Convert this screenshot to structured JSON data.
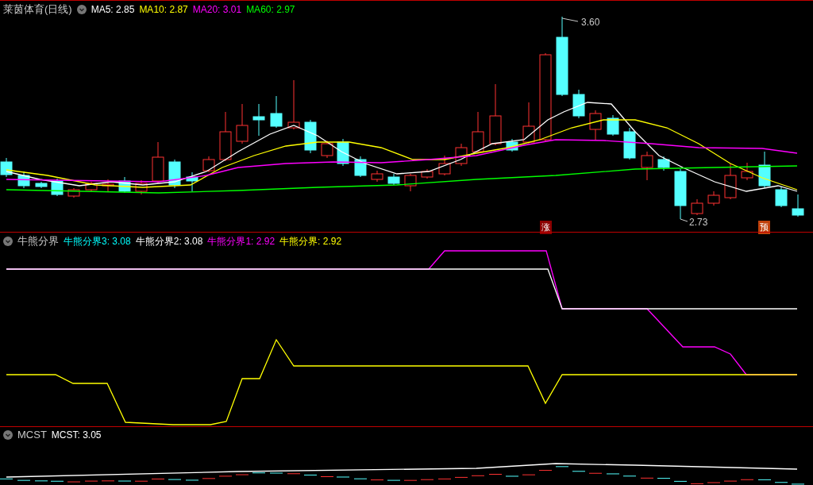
{
  "panels": [
    {
      "kind": "price",
      "title": "莱茵体育(日线)",
      "legend": [
        {
          "label": "MA5: 2.85",
          "color": "#ffffff"
        },
        {
          "label": "MA10: 2.87",
          "color": "#ffff00"
        },
        {
          "label": "MA20: 3.01",
          "color": "#ff00ff"
        },
        {
          "label": "MA60: 2.97",
          "color": "#00ff00"
        }
      ],
      "annotations": [
        {
          "text": "3.60"
        },
        {
          "text": "2.73"
        }
      ],
      "badges": [
        {
          "text": "涨",
          "color": "#8b0000"
        },
        {
          "text": "预",
          "color": "#c0400a"
        }
      ]
    },
    {
      "kind": "indicator",
      "title": "牛熊分界",
      "legend": [
        {
          "label": "牛熊分界3: 3.08",
          "color": "#00ffff"
        },
        {
          "label": "牛熊分界2: 3.08",
          "color": "#ffffff"
        },
        {
          "label": "牛熊分界1: 2.92",
          "color": "#ff00ff"
        },
        {
          "label": "牛熊分界: 2.92",
          "color": "#ffff00"
        }
      ]
    },
    {
      "kind": "volume",
      "title": "MCST",
      "legend": [
        {
          "label": "MCST: 3.05",
          "color": "#ffffff"
        }
      ]
    }
  ]
}
